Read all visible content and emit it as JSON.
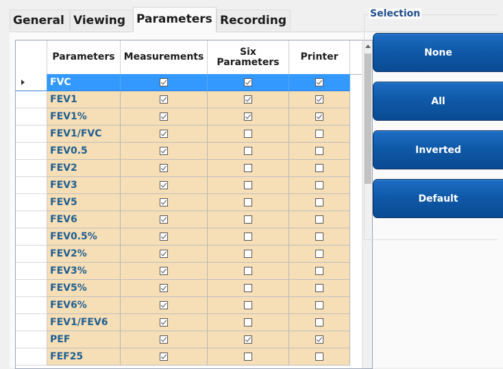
{
  "tabs": [
    {
      "label": "General"
    },
    {
      "label": "Viewing"
    },
    {
      "label": "Parameters"
    },
    {
      "label": "Recording"
    }
  ],
  "active_tab": "Parameters",
  "grid": {
    "headers": {
      "parameters": "Parameters",
      "measurements": "Measurements",
      "six_parameters_line1": "Six",
      "six_parameters_line2": "Parameters",
      "printer": "Printer"
    },
    "rows": [
      {
        "name": "FVC",
        "measurements": true,
        "six": true,
        "printer": true,
        "selected": true
      },
      {
        "name": "FEV1",
        "measurements": true,
        "six": true,
        "printer": true
      },
      {
        "name": "FEV1%",
        "measurements": true,
        "six": true,
        "printer": true
      },
      {
        "name": "FEV1/FVC",
        "measurements": true,
        "six": false,
        "printer": false
      },
      {
        "name": "FEV0.5",
        "measurements": true,
        "six": false,
        "printer": false
      },
      {
        "name": "FEV2",
        "measurements": true,
        "six": false,
        "printer": false
      },
      {
        "name": "FEV3",
        "measurements": true,
        "six": false,
        "printer": false
      },
      {
        "name": "FEV5",
        "measurements": true,
        "six": false,
        "printer": false
      },
      {
        "name": "FEV6",
        "measurements": true,
        "six": false,
        "printer": false
      },
      {
        "name": "FEV0.5%",
        "measurements": true,
        "six": false,
        "printer": false
      },
      {
        "name": "FEV2%",
        "measurements": true,
        "six": false,
        "printer": false
      },
      {
        "name": "FEV3%",
        "measurements": true,
        "six": false,
        "printer": false
      },
      {
        "name": "FEV5%",
        "measurements": true,
        "six": false,
        "printer": false
      },
      {
        "name": "FEV6%",
        "measurements": true,
        "six": false,
        "printer": false
      },
      {
        "name": "FEV1/FEV6",
        "measurements": true,
        "six": false,
        "printer": false
      },
      {
        "name": "PEF",
        "measurements": true,
        "six": true,
        "printer": true
      },
      {
        "name": "FEF25",
        "measurements": true,
        "six": false,
        "printer": false
      }
    ]
  },
  "selection": {
    "title": "Selection",
    "buttons": {
      "none": "None",
      "all": "All",
      "inverted": "Inverted",
      "default": "Default"
    }
  },
  "colors": {
    "row_background": "#f6deb6",
    "selected_row": "#3399ff",
    "parameter_text": "#1e5f92",
    "button": "#0f59a8"
  },
  "icons": {
    "row_indicator": "triangle-right",
    "scroll_up": "triangle-up"
  }
}
